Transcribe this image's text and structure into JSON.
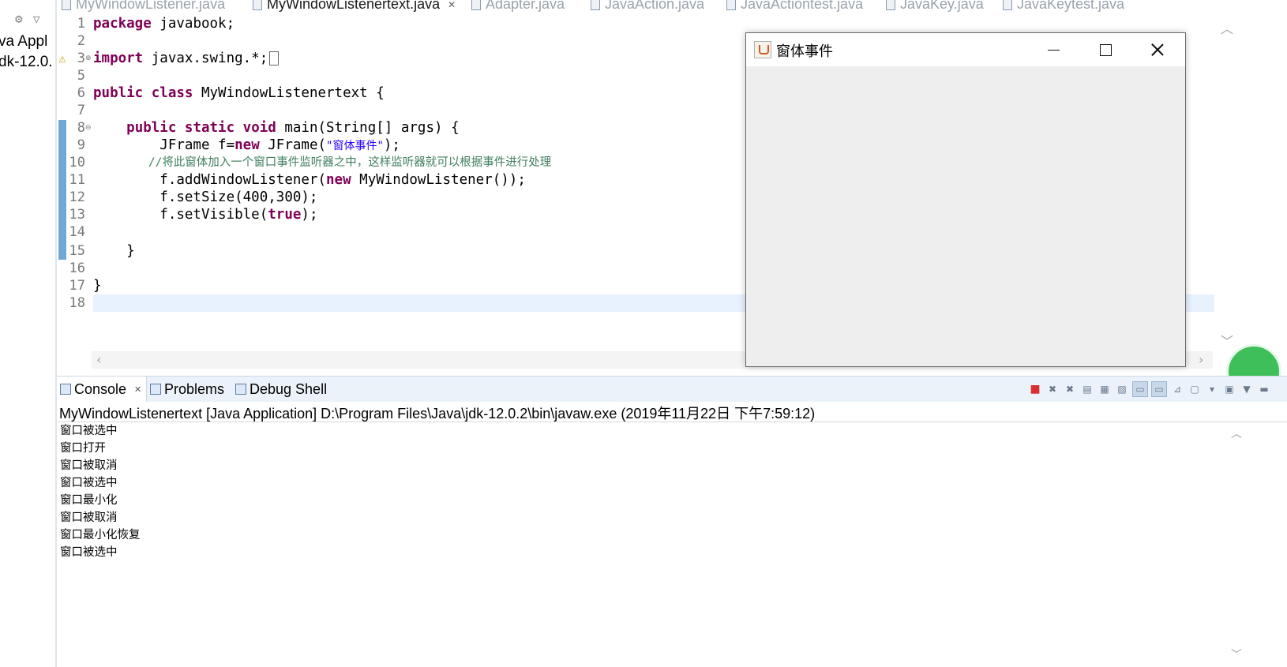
{
  "left_pane": {
    "lines": [
      "va Appl",
      "dk-12.0."
    ]
  },
  "editor_tabs": [
    {
      "label": "MyWindowListener.java",
      "active": false
    },
    {
      "label": "MyWindowListenertext.java",
      "active": true,
      "close": "✕"
    },
    {
      "label": "Adapter.java",
      "active": false
    },
    {
      "label": "JavaAction.java",
      "active": false
    },
    {
      "label": "JavaActiontest.java",
      "active": false
    },
    {
      "label": "JavaKey.java",
      "active": false
    },
    {
      "label": "JavaKeytest.java",
      "active": false
    }
  ],
  "editor": {
    "line_numbers": [
      "1",
      "2",
      "3",
      "5",
      "6",
      "7",
      "8",
      "9",
      "10",
      "11",
      "12",
      "13",
      "14",
      "15",
      "16",
      "17",
      "18"
    ],
    "code": {
      "l1_kw": "package",
      "l1_rest": " javabook;",
      "l3_kw": "import",
      "l3_rest": " javax.swing.*;",
      "l6_kw": "public class",
      "l6_rest": " MyWindowListenertext {",
      "l8_indent": "    ",
      "l8_kw": "public static void",
      "l8_rest": " main(String[] args) {",
      "l9_a": "        JFrame f=",
      "l9_kw": "new",
      "l9_b": " JFrame(",
      "l9_str": "\"窗体事件\"",
      "l9_c": ");",
      "l10_cmt": "        //将此窗体加入一个窗口事件监听器之中，这样监听器就可以根据事件进行处理",
      "l11_a": "        f.addWindowListener(",
      "l11_kw": "new",
      "l11_b": " MyWindowListener());",
      "l12": "        f.setSize(400,300);",
      "l13_a": "        f.setVisible(",
      "l13_kw": "true",
      "l13_b": ");",
      "l15": "    }",
      "l17": "}"
    }
  },
  "jframe": {
    "title": "窗体事件"
  },
  "console_tabs": [
    {
      "label": "Console",
      "active": true,
      "close": "✕"
    },
    {
      "label": "Problems",
      "active": false
    },
    {
      "label": "Debug Shell",
      "active": false
    }
  ],
  "console": {
    "header": "MyWindowListenertext [Java Application] D:\\Program Files\\Java\\jdk-12.0.2\\bin\\javaw.exe (2019年11月22日 下午7:59:12)",
    "output": [
      "窗口被选中",
      "窗口打开",
      "窗口被取消",
      "窗口被选中",
      "窗口最小化",
      "窗口被取消",
      "窗口最小化恢复",
      "窗口被选中"
    ]
  },
  "icons": {
    "terminate": "stop-icon",
    "remove_launch": "remove-launch-icon",
    "remove_all": "remove-all-icon"
  },
  "colors": {
    "keyword": "#7f0055",
    "string": "#2a00ff",
    "comment": "#3f7f5f",
    "current_line": "#e8f2fe",
    "change_bar": "#6fa8d4"
  }
}
